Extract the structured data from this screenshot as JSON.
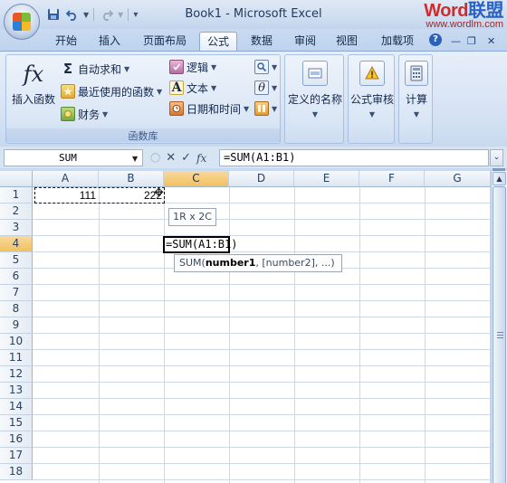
{
  "window": {
    "title": "Book1 - Microsoft Excel"
  },
  "watermark": {
    "logo_a": "Word",
    "logo_b": "联盟",
    "url": "www.wordlm.com"
  },
  "qat": {
    "save_icon": "save-icon",
    "undo_icon": "undo-icon",
    "redo_icon": "redo-icon",
    "customize_icon": "customize-icon"
  },
  "tabs": [
    {
      "label": "开始"
    },
    {
      "label": "插入"
    },
    {
      "label": "页面布局"
    },
    {
      "label": "公式",
      "active": true
    },
    {
      "label": "数据"
    },
    {
      "label": "审阅"
    },
    {
      "label": "视图"
    },
    {
      "label": "加载项"
    }
  ],
  "ribbon": {
    "function_library": {
      "group_label": "函数库",
      "insert_function": {
        "icon_text": "fx",
        "label": "插入函数"
      },
      "autosum": {
        "icon_text": "Σ",
        "label": "自动求和"
      },
      "recent": {
        "label": "最近使用的函数"
      },
      "financial": {
        "label": "财务"
      },
      "logical": {
        "label": "逻辑"
      },
      "text": {
        "label": "文本"
      },
      "datetime": {
        "label": "日期和时间"
      }
    },
    "defined_names": {
      "label": "定义的名称"
    },
    "formula_auditing": {
      "label": "公式审核"
    },
    "calculation": {
      "label": "计算"
    }
  },
  "formula_bar": {
    "name_box": "SUM",
    "cancel_glyph": "✕",
    "enter_glyph": "✓",
    "fx_glyph": "fx",
    "formula": "=SUM(A1:B1)"
  },
  "sheet": {
    "columns": [
      "A",
      "B",
      "C",
      "D",
      "E",
      "F",
      "G"
    ],
    "rows": [
      "1",
      "2",
      "3",
      "4",
      "5",
      "6",
      "7",
      "8",
      "9",
      "10",
      "11",
      "12",
      "13",
      "14",
      "15",
      "16",
      "17",
      "18"
    ],
    "cells": {
      "A1": "111",
      "B1": "222",
      "C4": "=SUM(A1:B1)"
    },
    "range_tooltip": "1R x 2C",
    "signature_tooltip": {
      "func": "SUM(",
      "arg_bold": "number1",
      "rest": ", [number2], ...)"
    }
  }
}
